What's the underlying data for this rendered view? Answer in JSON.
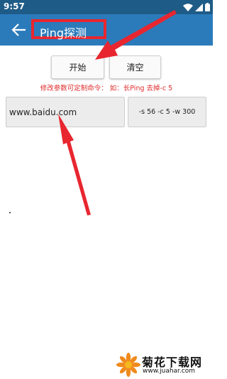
{
  "status_bar": {
    "time": "9:57",
    "icons": [
      "wifi-icon",
      "signal-icon",
      "battery-icon"
    ]
  },
  "app_bar": {
    "title": "Ping探测",
    "back_icon": "arrow-left-icon",
    "background": "#2b7bbb"
  },
  "buttons": {
    "start_label": "开始",
    "clear_label": "清空"
  },
  "hint": {
    "text": "修改参数可定制命令：  如：长Ping 去掉-c 5",
    "color": "#e02b2b"
  },
  "form": {
    "host_value": "www.baidu.com",
    "params_value": "-s 56 -c 5 -w 300"
  },
  "watermark": {
    "title": "菊花下载网",
    "url": "www.juahar.com"
  },
  "annotation": {
    "color": "#e8262f"
  }
}
